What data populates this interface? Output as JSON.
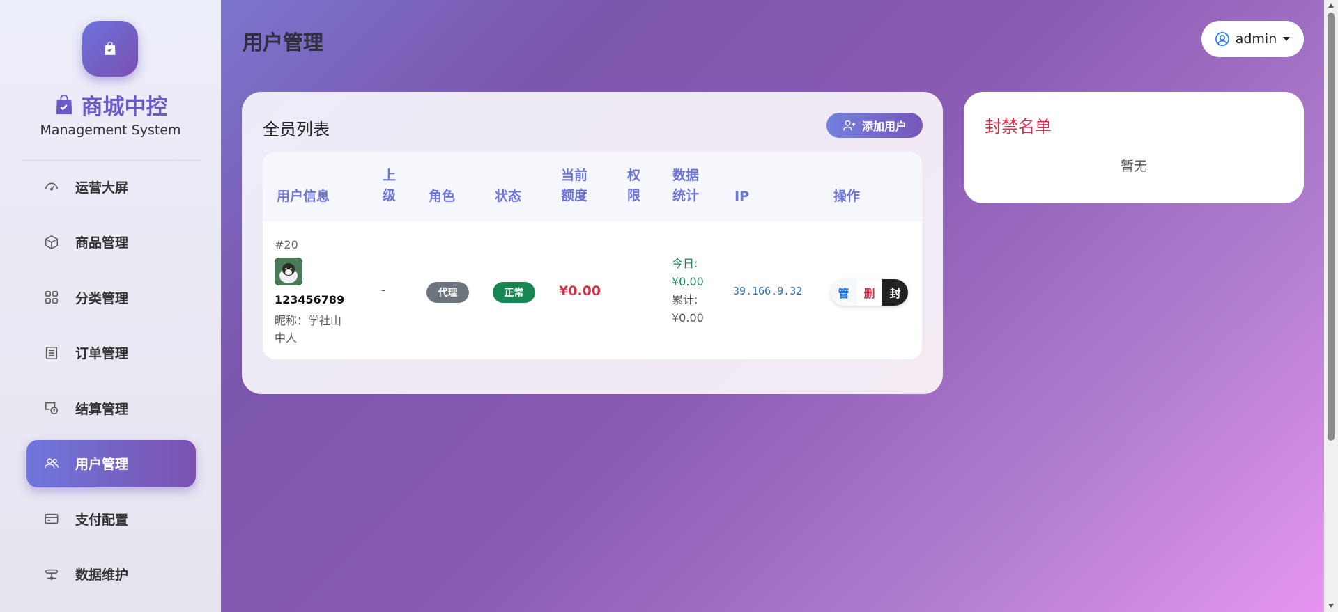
{
  "brand": {
    "title": "商城中控",
    "subtitle": "Management System"
  },
  "sidebar": {
    "items": [
      {
        "label": "运营大屏",
        "icon": "speedometer-icon",
        "active": false
      },
      {
        "label": "商品管理",
        "icon": "box-icon",
        "active": false
      },
      {
        "label": "分类管理",
        "icon": "grid-icon",
        "active": false
      },
      {
        "label": "订单管理",
        "icon": "list-icon",
        "active": false
      },
      {
        "label": "结算管理",
        "icon": "cash-icon",
        "active": false
      },
      {
        "label": "用户管理",
        "icon": "people-icon",
        "active": true
      },
      {
        "label": "支付配置",
        "icon": "credit-card-icon",
        "active": false
      },
      {
        "label": "数据维护",
        "icon": "sliders-icon",
        "active": false
      }
    ]
  },
  "header": {
    "title": "用户管理",
    "user": "admin"
  },
  "users_card": {
    "title": "全员列表",
    "add_button": "添加用户",
    "columns": [
      "用户信息",
      "上级",
      "角色",
      "状态",
      "当前额度",
      "权限",
      "数据统计",
      "IP",
      "操作"
    ],
    "columns_wrapped": {
      "superior": [
        "上",
        "级"
      ],
      "quota": [
        "当前",
        "额度"
      ],
      "permission": [
        "权",
        "限"
      ],
      "stats": [
        "数据",
        "统计"
      ]
    },
    "rows": [
      {
        "id": "#20",
        "username": "123456789",
        "nickname_line1": "昵称：学社山",
        "nickname_line2": "中人",
        "superior": "-",
        "role": "代理",
        "status": "正常",
        "quota": "¥0.00",
        "permission": "",
        "today_label": "今日:",
        "today_value": "¥0.00",
        "total_label": "累计:",
        "total_value": "¥0.00",
        "ip": "39.166.9.32",
        "actions": {
          "manage": "管",
          "delete": "删",
          "ban": "封"
        }
      }
    ]
  },
  "banned_card": {
    "title": "封禁名单",
    "empty_text": "暂无"
  },
  "colors": {
    "accent": "#6b74d8",
    "danger": "#d0334a",
    "success": "#198754",
    "role_badge": "#6c757d",
    "ip": "#2f6fb8"
  }
}
